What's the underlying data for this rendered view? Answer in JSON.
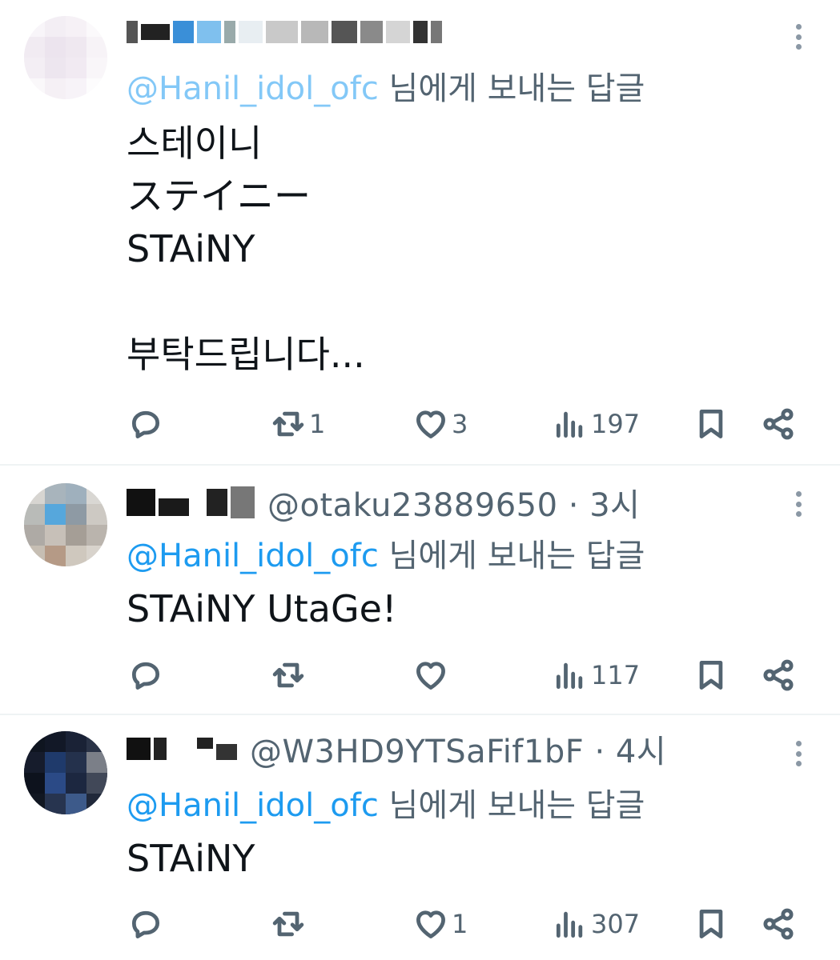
{
  "tweets": [
    {
      "author_censored": true,
      "handle_meta": "",
      "reply_prefix": "@Hanil_idol_ofc",
      "reply_suffix": " 님에게 보내는 답글",
      "body": "스테이니\nステイニー\nSTAiNY\n\n부탁드립니다...",
      "actions": {
        "reply": "",
        "retweet": "1",
        "like": "3",
        "views": "197"
      }
    },
    {
      "author_censored": true,
      "handle_meta": "@otaku23889650 · 3시",
      "reply_prefix": "@Hanil_idol_ofc",
      "reply_suffix": " 님에게 보내는 답글",
      "body": "STAiNY UtaGe!",
      "actions": {
        "reply": "",
        "retweet": "",
        "like": "",
        "views": "117"
      }
    },
    {
      "author_censored": true,
      "handle_meta": "@W3HD9YTSaFif1bF · 4시",
      "reply_prefix": "@Hanil_idol_ofc",
      "reply_suffix": " 님에게 보내는 답글",
      "body": "STAiNY",
      "actions": {
        "reply": "",
        "retweet": "",
        "like": "1",
        "views": "307"
      }
    }
  ],
  "colors": {
    "text": "#0f1419",
    "muted": "#536471",
    "link": "#1d9bf0",
    "divider": "#eff3f4"
  },
  "icons": [
    "reply-icon",
    "retweet-icon",
    "like-icon",
    "views-icon",
    "bookmark-icon",
    "share-icon",
    "more-icon"
  ]
}
